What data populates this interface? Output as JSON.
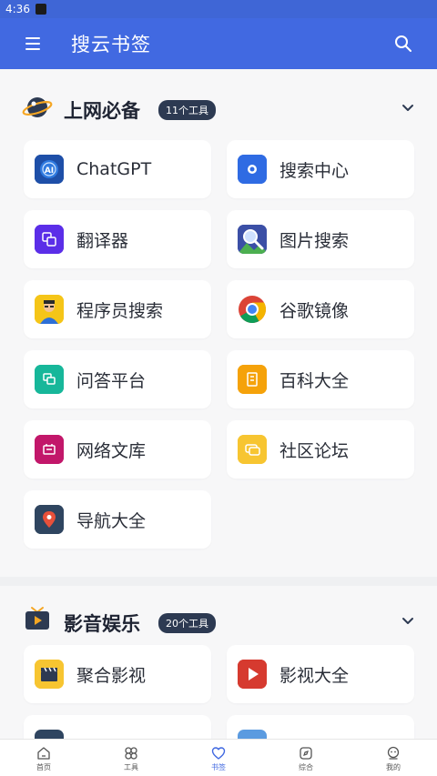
{
  "status": {
    "time": "4:36"
  },
  "app": {
    "title": "搜云书签"
  },
  "sections": [
    {
      "title": "上网必备",
      "badge": "11个工具",
      "tools": [
        {
          "label": "ChatGPT",
          "icon": "ai-chip-icon"
        },
        {
          "label": "搜索中心",
          "icon": "search-center-icon"
        },
        {
          "label": "翻译器",
          "icon": "translate-icon"
        },
        {
          "label": "图片搜索",
          "icon": "image-search-icon"
        },
        {
          "label": "程序员搜索",
          "icon": "programmer-avatar-icon"
        },
        {
          "label": "谷歌镜像",
          "icon": "chrome-icon"
        },
        {
          "label": "问答平台",
          "icon": "qa-icon"
        },
        {
          "label": "百科大全",
          "icon": "encyclopedia-icon"
        },
        {
          "label": "网络文库",
          "icon": "library-icon"
        },
        {
          "label": "社区论坛",
          "icon": "forum-icon"
        },
        {
          "label": "导航大全",
          "icon": "location-pin-icon"
        }
      ]
    },
    {
      "title": "影音娱乐",
      "badge": "20个工具",
      "tools": [
        {
          "label": "聚合影视",
          "icon": "clapperboard-icon"
        },
        {
          "label": "影视大全",
          "icon": "play-icon"
        }
      ]
    }
  ],
  "nav": [
    {
      "label": "首页",
      "icon": "home-icon"
    },
    {
      "label": "工具",
      "icon": "tools-icon"
    },
    {
      "label": "书签",
      "icon": "bookmark-heart-icon",
      "active": true
    },
    {
      "label": "综合",
      "icon": "compass-icon"
    },
    {
      "label": "我的",
      "icon": "profile-icon"
    }
  ],
  "colors": {
    "primary": "#4169e1",
    "badge": "#2d3a52"
  }
}
